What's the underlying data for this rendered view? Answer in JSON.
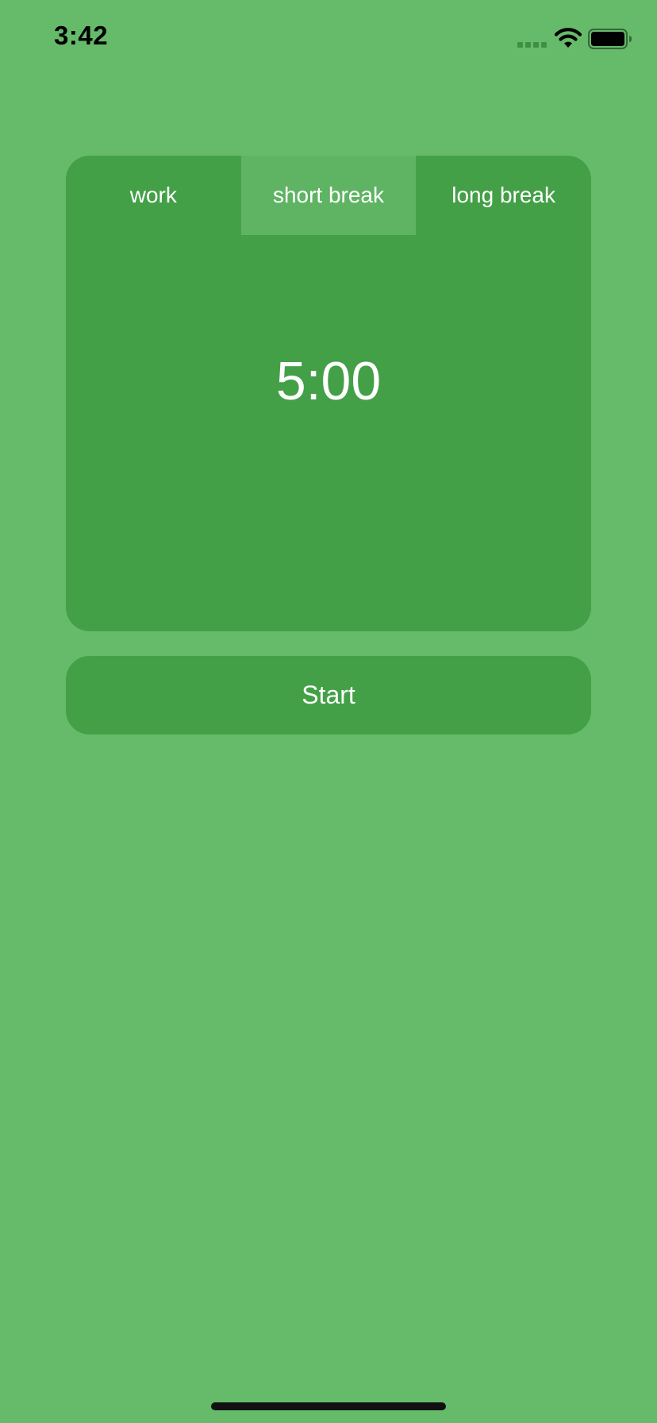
{
  "status_bar": {
    "time": "3:42",
    "icons": [
      "cellular-signal-icon",
      "wifi-icon",
      "battery-icon"
    ]
  },
  "timer": {
    "tabs": [
      {
        "label": "work",
        "active": false
      },
      {
        "label": "short break",
        "active": true
      },
      {
        "label": "long break",
        "active": false
      }
    ],
    "display": "5:00"
  },
  "actions": {
    "start_label": "Start"
  },
  "colors": {
    "background": "#66BB6A",
    "card": "#43A047",
    "active_tab": "#5FB463",
    "text": "#FFFFFF"
  }
}
